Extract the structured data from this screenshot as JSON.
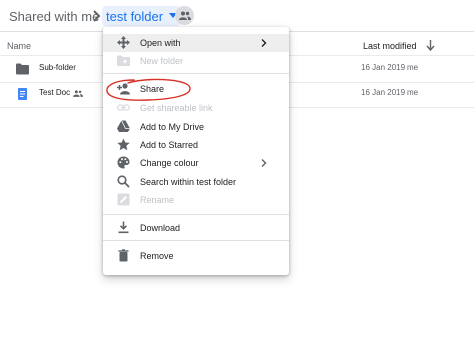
{
  "breadcrumb": {
    "root": "Shared with me",
    "current": "test folder"
  },
  "columns": {
    "name": "Name",
    "last_modified": "Last modified"
  },
  "files": [
    {
      "name": "Sub-folder",
      "type": "folder",
      "date": "16 Jan 2019",
      "owner": "me",
      "shared": false
    },
    {
      "name": "Test Doc",
      "type": "doc",
      "date": "16 Jan 2019",
      "owner": "me",
      "shared": true
    }
  ],
  "menu": {
    "items": [
      {
        "label": "Open with",
        "icon": "open-with-icon",
        "submenu": true,
        "highlighted": true
      },
      {
        "label": "New folder",
        "icon": "new-folder-icon",
        "disabled": true
      },
      {
        "label": "Share",
        "icon": "share-person-icon",
        "circled": true
      },
      {
        "label": "Get shareable link",
        "icon": "link-icon",
        "disabled": true
      },
      {
        "label": "Add to My Drive",
        "icon": "drive-icon"
      },
      {
        "label": "Add to Starred",
        "icon": "star-icon"
      },
      {
        "label": "Change colour",
        "icon": "palette-icon",
        "submenu": true
      },
      {
        "label": "Search within test folder",
        "icon": "search-icon"
      },
      {
        "label": "Rename",
        "icon": "rename-icon",
        "disabled": true
      },
      {
        "label": "Download",
        "icon": "download-icon"
      },
      {
        "label": "Remove",
        "icon": "trash-icon"
      }
    ]
  },
  "colors": {
    "accent": "#1a73e8",
    "breadcrumb_highlight": "#e8f0fe",
    "menu_hover": "#eeeeee",
    "annotation": "#d93025",
    "icon": "#5f6368",
    "doc_blue": "#4285f4"
  }
}
